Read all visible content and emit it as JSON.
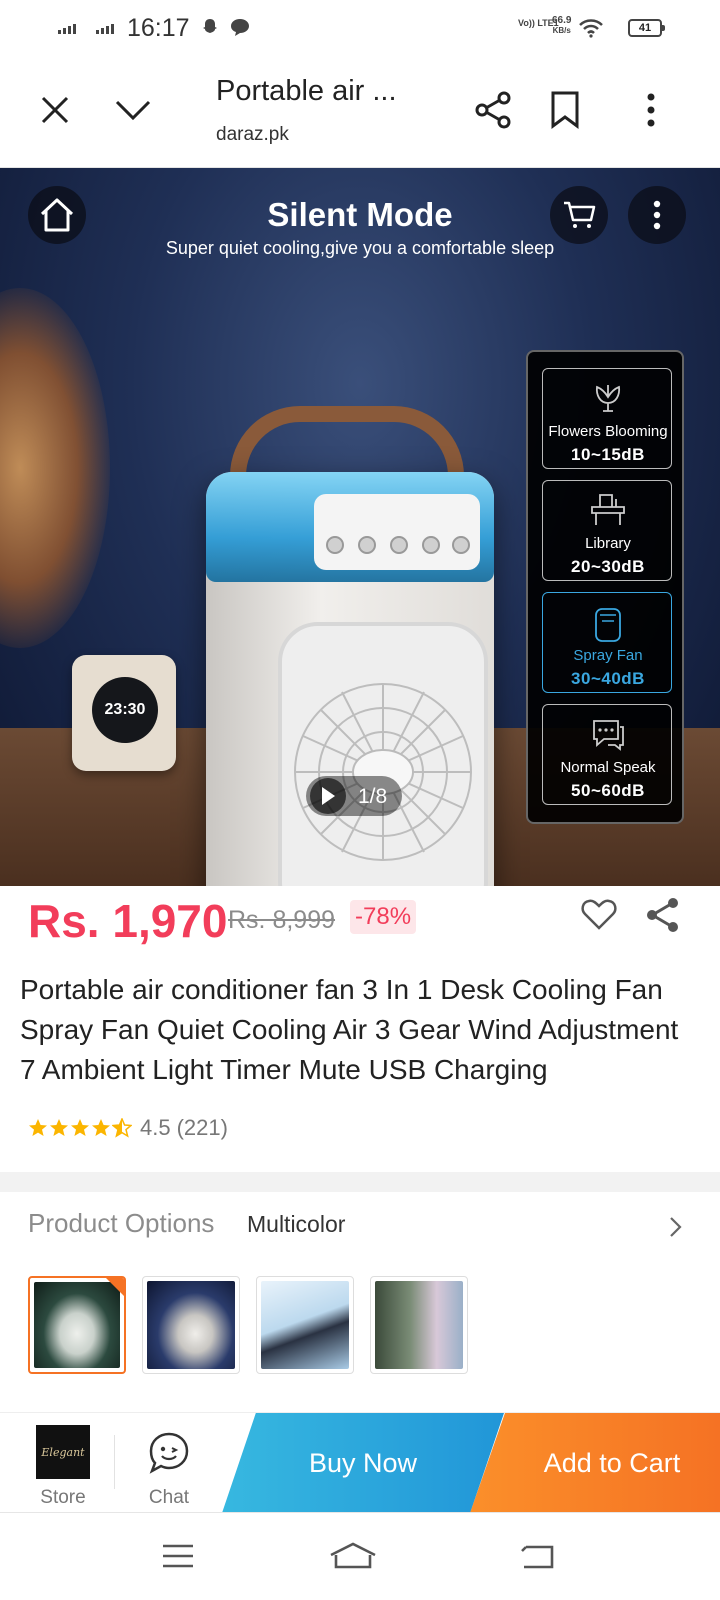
{
  "status_bar": {
    "time": "16:17",
    "network_label": "Vo)) LTE1",
    "net_speed_value": "66.9",
    "net_speed_unit": "KB/s",
    "battery": "41"
  },
  "browser": {
    "title": "Portable air ...",
    "domain": "daraz.pk"
  },
  "hero": {
    "headline": "Silent Mode",
    "subline": "Super quiet cooling,give you a comfortable sleep",
    "clock_time": "23:30",
    "image_counter": "1/8",
    "modes": [
      {
        "name": "Flowers Blooming",
        "db": "10~15dB",
        "icon": "flower-icon",
        "active": false
      },
      {
        "name": "Library",
        "db": "20~30dB",
        "icon": "library-icon",
        "active": false
      },
      {
        "name": "Spray Fan",
        "db": "30~40dB",
        "icon": "fan-icon",
        "active": true
      },
      {
        "name": "Normal Speak",
        "db": "50~60dB",
        "icon": "chat-bubble-icon",
        "active": false
      }
    ]
  },
  "product": {
    "price": "Rs. 1,970",
    "original_price": "Rs. 8,999",
    "discount": "-78%",
    "title": "Portable air conditioner fan 3 In 1 Desk Cooling Fan Spray Fan Quiet Cooling Air 3 Gear Wind Adjustment 7 Ambient Light Timer Mute USB Charging",
    "rating": "4.5",
    "rating_count": "(221)",
    "stars_filled": 4.5
  },
  "options": {
    "label": "Product Options",
    "value": "Multicolor",
    "thumbnails": [
      {
        "name": "option-thumb-1",
        "selected": true,
        "colors": [
          "#2c4a3f",
          "#0f1d18"
        ]
      },
      {
        "name": "option-thumb-2",
        "selected": false,
        "colors": [
          "#2a3b6b",
          "#0d1530"
        ]
      },
      {
        "name": "option-thumb-3",
        "selected": false,
        "colors": [
          "#e9f3fb",
          "#a9cbe6"
        ]
      },
      {
        "name": "option-thumb-4",
        "selected": false,
        "colors": [
          "#7a8c76",
          "#3b4a3a"
        ]
      }
    ]
  },
  "action_bar": {
    "store_label": "Store",
    "store_logo_text": "Elegant",
    "chat_label": "Chat",
    "buy_now": "Buy Now",
    "add_to_cart": "Add to Cart"
  },
  "colors": {
    "price": "#f23d5a",
    "buy_now": "#2196d8",
    "add_to_cart": "#f57224"
  }
}
